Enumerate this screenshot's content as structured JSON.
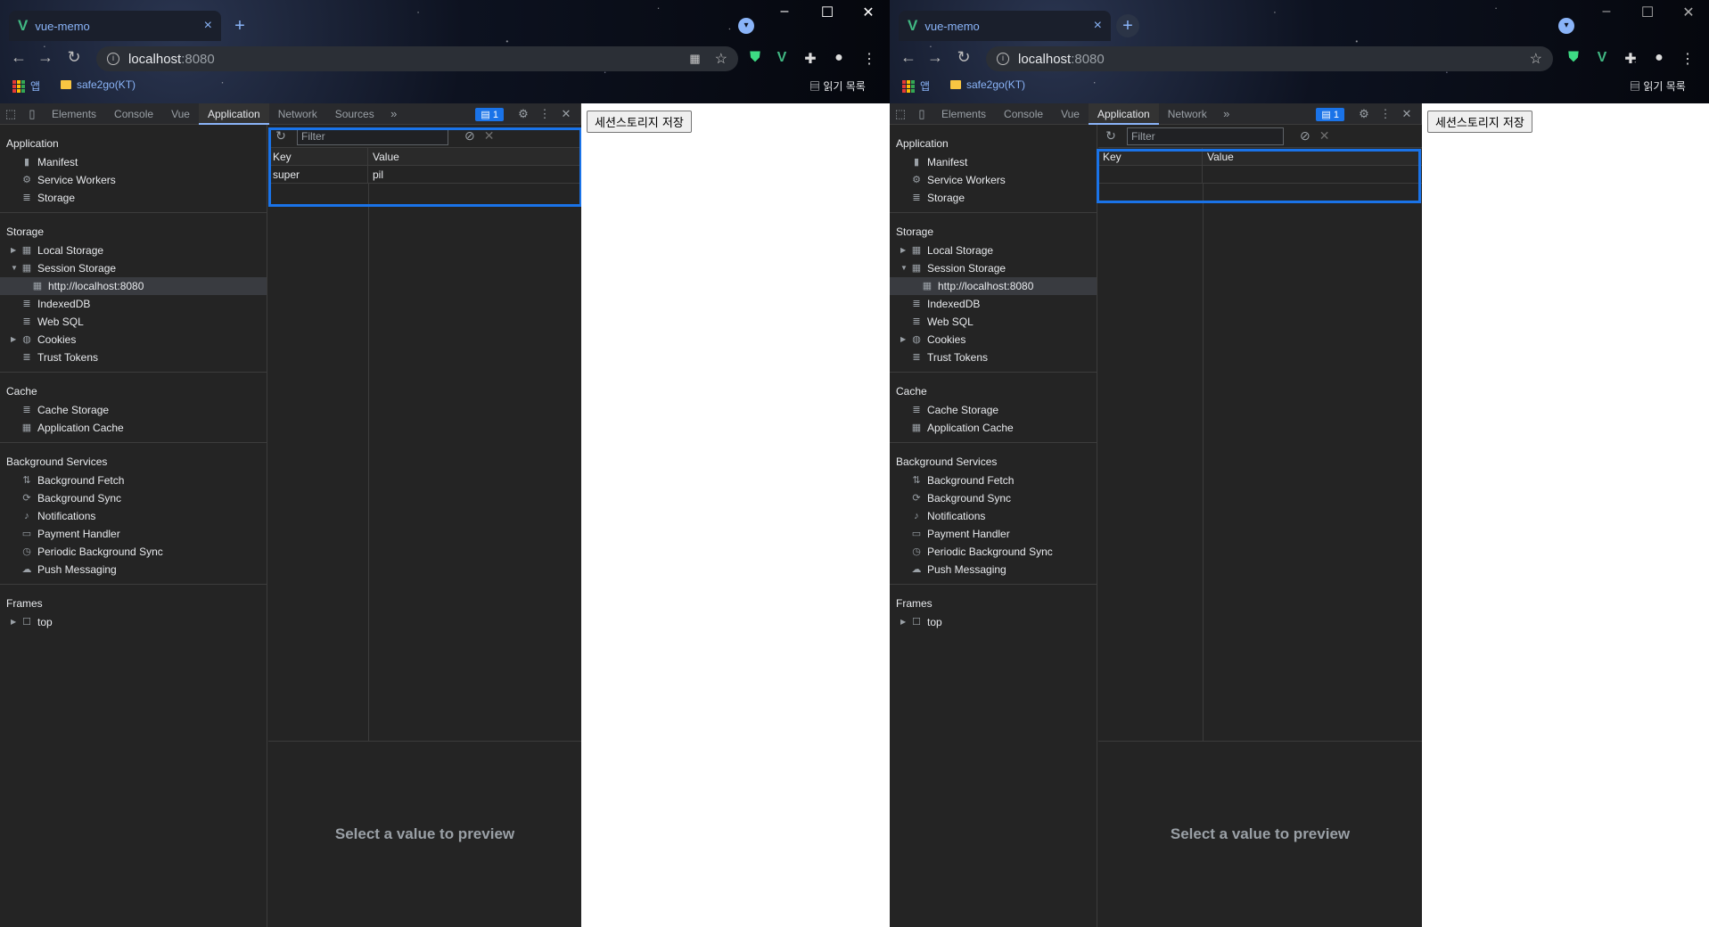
{
  "windows": [
    {
      "tab_title": "vue-memo",
      "address_host": "localhost",
      "address_port": ":8080",
      "bookmarks": {
        "apps_label": "앱",
        "folder_label": "safe2go(KT)",
        "reading_list": "읽기 목록"
      },
      "devtools": {
        "tabs": [
          "Elements",
          "Console",
          "Vue",
          "Application",
          "Network",
          "Sources"
        ],
        "active_tab": "Application",
        "message_count": "1",
        "sidebar": {
          "application": {
            "header": "Application",
            "items": [
              "Manifest",
              "Service Workers",
              "Storage"
            ]
          },
          "storage": {
            "header": "Storage",
            "items": [
              "Local Storage",
              "Session Storage",
              "http://localhost:8080",
              "IndexedDB",
              "Web SQL",
              "Cookies",
              "Trust Tokens"
            ]
          },
          "cache": {
            "header": "Cache",
            "items": [
              "Cache Storage",
              "Application Cache"
            ]
          },
          "background": {
            "header": "Background Services",
            "items": [
              "Background Fetch",
              "Background Sync",
              "Notifications",
              "Payment Handler",
              "Periodic Background Sync",
              "Push Messaging"
            ]
          },
          "frames": {
            "header": "Frames",
            "items": [
              "top"
            ]
          }
        },
        "filter_placeholder": "Filter",
        "table": {
          "headers": [
            "Key",
            "Value"
          ],
          "rows": [
            {
              "key": "super",
              "value": "pil"
            }
          ]
        },
        "preview_text": "Select a value to preview"
      },
      "page_button": "세션스토리지 저장"
    },
    {
      "tab_title": "vue-memo",
      "address_host": "localhost",
      "address_port": ":8080",
      "bookmarks": {
        "apps_label": "앱",
        "folder_label": "safe2go(KT)",
        "reading_list": "읽기 목록"
      },
      "devtools": {
        "tabs": [
          "Elements",
          "Console",
          "Vue",
          "Application",
          "Network"
        ],
        "active_tab": "Application",
        "message_count": "1",
        "sidebar": {
          "application": {
            "header": "Application",
            "items": [
              "Manifest",
              "Service Workers",
              "Storage"
            ]
          },
          "storage": {
            "header": "Storage",
            "items": [
              "Local Storage",
              "Session Storage",
              "http://localhost:8080",
              "IndexedDB",
              "Web SQL",
              "Cookies",
              "Trust Tokens"
            ]
          },
          "cache": {
            "header": "Cache",
            "items": [
              "Cache Storage",
              "Application Cache"
            ]
          },
          "background": {
            "header": "Background Services",
            "items": [
              "Background Fetch",
              "Background Sync",
              "Notifications",
              "Payment Handler",
              "Periodic Background Sync",
              "Push Messaging"
            ]
          },
          "frames": {
            "header": "Frames",
            "items": [
              "top"
            ]
          }
        },
        "filter_placeholder": "Filter",
        "table": {
          "headers": [
            "Key",
            "Value"
          ],
          "rows": []
        },
        "preview_text": "Select a value to preview"
      },
      "page_button": "세션스토리지 저장"
    }
  ],
  "colors": {
    "highlight": "#1a73e8",
    "vue_green": "#41b883",
    "link_blue": "#8ab4f8"
  }
}
